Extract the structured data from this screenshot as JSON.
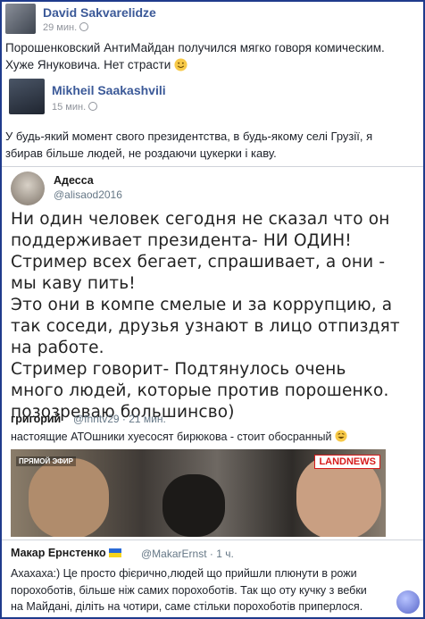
{
  "post1": {
    "author": "David Sakvarelidze",
    "time": "29 мин.",
    "text_line1": "Порошенковский АнтиМайдан получился мягко говоря комическим.",
    "text_line2": "Хуже Януковича. Нет страсти",
    "emoji_icon": "smile-icon"
  },
  "post2": {
    "author": "Mikheil Saakashvili",
    "time": "15 мин.",
    "text_line1": "У будь-який момент свого президентства, в будь-якому селі Грузії, я",
    "text_line2": "збирав більше людей, не роздаючи цукерки і каву."
  },
  "tweet1": {
    "name": "Адесса",
    "handle": "@alisaod2016",
    "lines": [
      "Ни один человек сегодня не сказал что он",
      "поддерживает президента- НИ ОДИН!",
      "Стример всех бегает, спрашивает, а они -",
      "мы каву пить!",
      "Это они в компе смелые и за коррупцию, а",
      "так соседи, друзья узнают в лицо отпиздят",
      "на работе.",
      "Стример говорит- Подтянулось очень",
      "много людей, которые против порошенко.",
      "позозреваю большинсво)"
    ]
  },
  "tweet2": {
    "name": "григорий",
    "handle": "@fhntv29 · 21 мин.",
    "text": "настоящие АТОшники хуесосят бирюкова - стоит обосранный",
    "emoji_icon": "rolling-laugh-icon",
    "video_overlay": "ПРЯМОЙ ЭФИР",
    "video_logo": "LANDNEWS"
  },
  "tweet3": {
    "name": "Макар Ернстенко",
    "handle": "@MakarErnst · 1 ч.",
    "text_line1": "Ахахаха:) Це просто фієрично,людей що прийшли плюнути в рожи",
    "text_line2": "порохоботів, більше ніж самих порохоботів. Так що оту кучку з вебки",
    "text_line3": "на Майдані, діліть на чотири, саме стільки порохоботів приперлося."
  },
  "colors": {
    "fb_name": "#3b5998",
    "frame": "#1f3b8c"
  }
}
